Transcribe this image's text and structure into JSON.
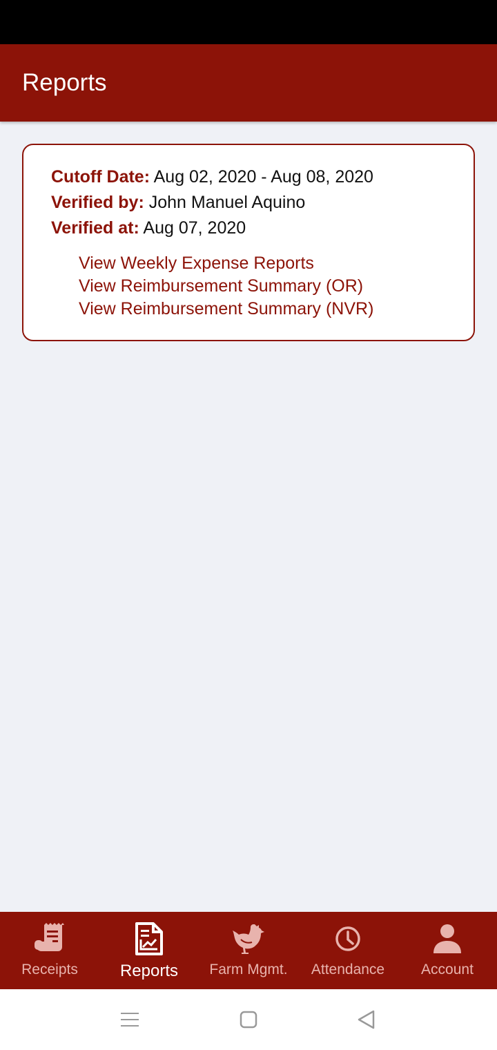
{
  "app_bar": {
    "title": "Reports"
  },
  "report_card": {
    "cutoff_label": "Cutoff Date:",
    "cutoff_value": "Aug 02, 2020 - Aug 08, 2020",
    "verified_by_label": "Verified by:",
    "verified_by_value": "John Manuel Aquino",
    "verified_at_label": "Verified at:",
    "verified_at_value": "Aug 07, 2020",
    "links": [
      "View Weekly Expense Reports",
      "View Reimbursement Summary (OR)",
      "View Reimbursement Summary (NVR)"
    ]
  },
  "bottom_nav": {
    "items": [
      {
        "label": "Receipts",
        "icon": "receipt-icon",
        "active": false
      },
      {
        "label": "Reports",
        "icon": "report-chart-icon",
        "active": true
      },
      {
        "label": "Farm Mgmt.",
        "icon": "chicken-icon",
        "active": false
      },
      {
        "label": "Attendance",
        "icon": "clock-icon",
        "active": false
      },
      {
        "label": "Account",
        "icon": "user-icon",
        "active": false
      }
    ]
  },
  "system_nav": {
    "icons": [
      "menu-icon",
      "home-icon",
      "back-icon"
    ]
  },
  "colors": {
    "primary": "#8c1308",
    "background": "#eff1f6",
    "inactive_nav": "#e8b3ad",
    "text": "#111111"
  }
}
